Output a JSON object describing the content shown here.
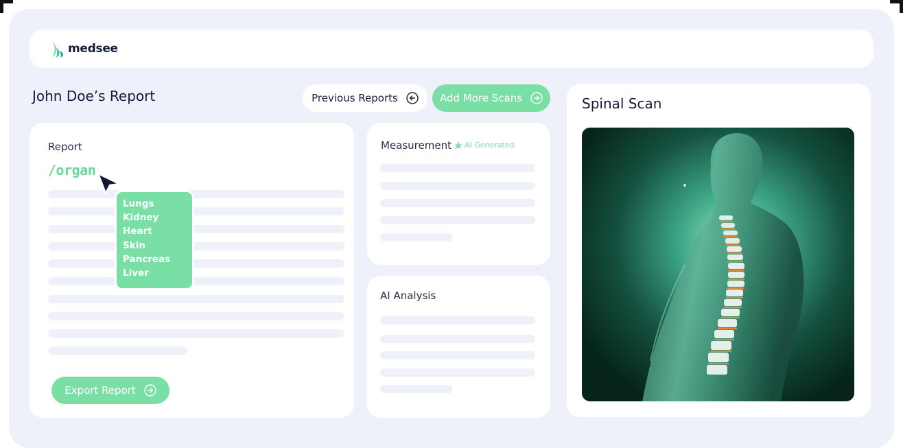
{
  "brand": {
    "name": "medsee"
  },
  "header": {
    "title": "John Doe’s Report"
  },
  "actions": {
    "previous_reports": "Previous Reports",
    "add_more_scans": "Add More Scans",
    "export_report": "Export Report"
  },
  "report": {
    "label": "Report",
    "command": "/organ",
    "organ_options": [
      "Lungs",
      "Kidney",
      "Heart",
      "Skin",
      "Pancreas",
      "Liver"
    ]
  },
  "measurement": {
    "label": "Measurement",
    "badge": "AI Generated"
  },
  "ai_analysis": {
    "label": "AI Analysis"
  },
  "scan": {
    "title": "Spinal Scan"
  },
  "colors": {
    "accent": "#7adfa4",
    "background": "#eef1fa",
    "text": "#131a3a"
  },
  "icons": {
    "previous_reports": "arrow-left-circle-icon",
    "add_more_scans": "arrow-right-circle-icon",
    "export_report": "arrow-right-circle-icon",
    "ai_badge": "star-icon",
    "cursor": "pointer-cursor-icon"
  }
}
